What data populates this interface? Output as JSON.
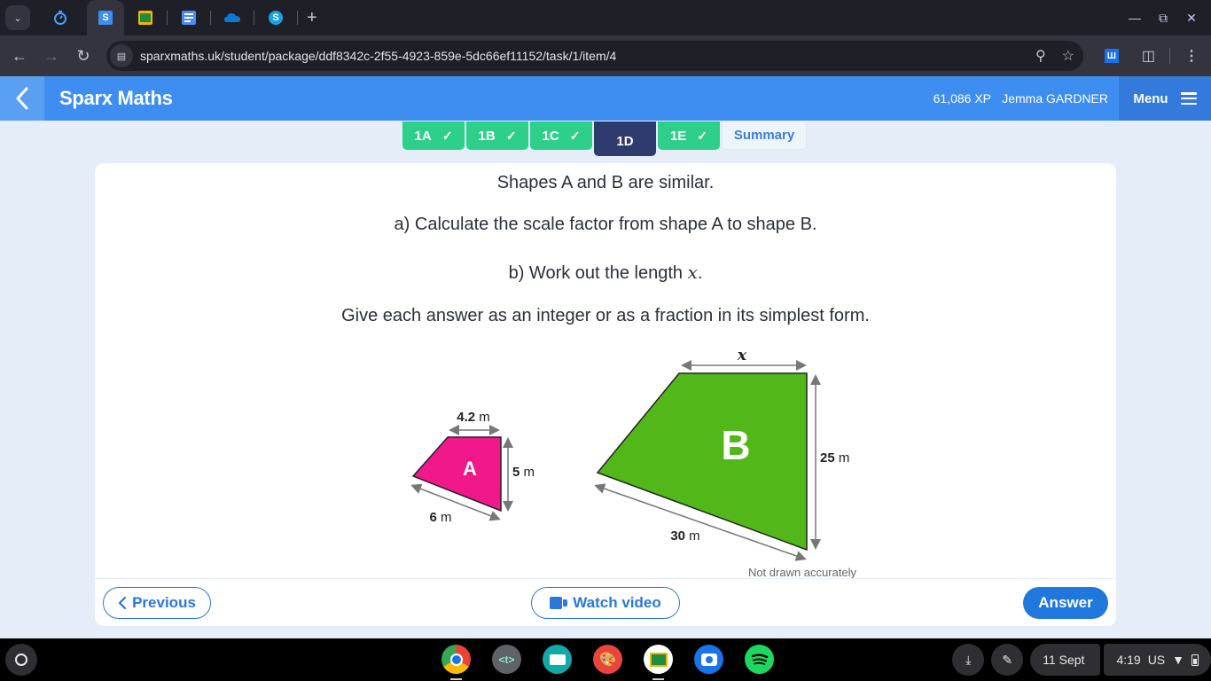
{
  "browser": {
    "tabs": [
      {
        "icon": "timer-icon",
        "color": "#4a9ef5",
        "active": false
      },
      {
        "icon": "sparx-icon",
        "label": "S",
        "color": "#3d8ef0",
        "active": true
      },
      {
        "icon": "google-classroom-icon",
        "color": "#f5b400",
        "active": false
      },
      {
        "icon": "google-docs-icon",
        "color": "#4b8bf5",
        "active": false
      },
      {
        "icon": "onedrive-icon",
        "color": "#0f78d4",
        "active": false
      },
      {
        "icon": "skype-icon",
        "label": "S",
        "color": "#1aa0e6",
        "active": false
      }
    ],
    "new_tab_label": "+",
    "url": "sparxmaths.uk/student/package/ddf8342c-2f55-4923-859e-5dc66ef11152/task/1/item/4",
    "extension_label": "Ш"
  },
  "app": {
    "brand": "Sparx Maths",
    "xp": "61,086 XP",
    "user": "Jemma GARDNER",
    "menu_label": "Menu",
    "accent": "#3d8ef0"
  },
  "task_tabs": [
    {
      "label": "1A",
      "complete": true,
      "current": false
    },
    {
      "label": "1B",
      "complete": true,
      "current": false
    },
    {
      "label": "1C",
      "complete": true,
      "current": false
    },
    {
      "label": "1D",
      "complete": false,
      "current": true
    },
    {
      "label": "1E",
      "complete": true,
      "current": false
    },
    {
      "label": "Summary",
      "complete": false,
      "current": false
    }
  ],
  "question": {
    "line1": "Shapes A and B are similar.",
    "line2": "a) Calculate the scale factor from shape A to shape B.",
    "line3_prefix": "b) Work out the length ",
    "line3_var": "x",
    "line3_suffix": ".",
    "line4": "Give each answer as an integer or as a fraction in its simplest form."
  },
  "diagram": {
    "shape_a": {
      "label": "A",
      "color": "#f0188a",
      "top": "4.2",
      "right": "5",
      "bottom": "6",
      "unit": "m"
    },
    "shape_b": {
      "label": "B",
      "color": "#52b81a",
      "top": "x",
      "right": "25",
      "bottom": "30",
      "unit": "m"
    },
    "note": "Not drawn accurately"
  },
  "actions": {
    "previous": "Previous",
    "watch_video": "Watch video",
    "answer": "Answer"
  },
  "shelf": {
    "apps": [
      {
        "name": "chrome",
        "color": "#ffffff"
      },
      {
        "name": "text-editor",
        "label": "<t>",
        "color": "#5f6368"
      },
      {
        "name": "slides",
        "color": "#14a9a9"
      },
      {
        "name": "canvas",
        "color": "#e8453c"
      },
      {
        "name": "classroom",
        "color": "#ffffff"
      },
      {
        "name": "camera",
        "color": "#1a73e8"
      },
      {
        "name": "spotify",
        "color": "#1ed760"
      }
    ],
    "date": "11 Sept",
    "time": "4:19",
    "locale": "US"
  }
}
